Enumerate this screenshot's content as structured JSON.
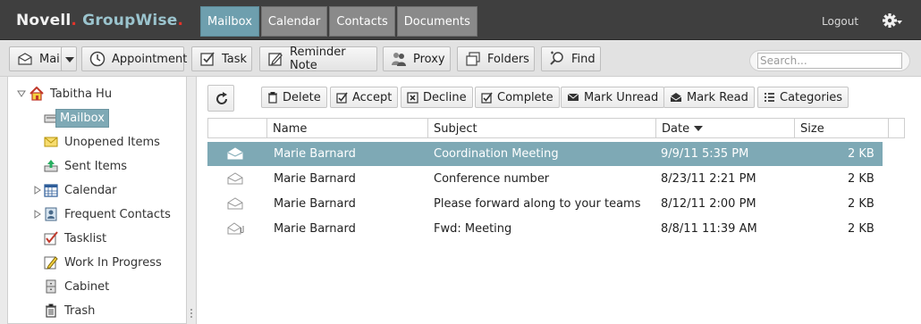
{
  "brand": {
    "novell": "Novell",
    "dot": ".",
    "groupwise": "GroupWise",
    "dot2": "."
  },
  "topnav": {
    "tabs": [
      "Mailbox",
      "Calendar",
      "Contacts",
      "Documents"
    ],
    "active_tab": "Mailbox"
  },
  "header": {
    "logout_label": "Logout",
    "settings_icon": "gear-icon"
  },
  "toolbar": {
    "mail_label": "Mail",
    "appointment_label": "Appointment",
    "task_label": "Task",
    "reminder_note_label": "Reminder Note",
    "proxy_label": "Proxy",
    "folders_label": "Folders",
    "find_label": "Find",
    "search_placeholder": "Search..."
  },
  "sidebar": {
    "user": "Tabitha Hu",
    "items": [
      {
        "label": "Mailbox",
        "icon": "mailbox-icon",
        "selected": true
      },
      {
        "label": "Unopened Items",
        "icon": "envelope-icon"
      },
      {
        "label": "Sent Items",
        "icon": "sent-items-icon"
      },
      {
        "label": "Calendar",
        "icon": "calendar-icon",
        "expandable": true
      },
      {
        "label": "Frequent Contacts",
        "icon": "contacts-icon",
        "expandable": true
      },
      {
        "label": "Tasklist",
        "icon": "checkmark-icon"
      },
      {
        "label": "Work In Progress",
        "icon": "pencil-note-icon"
      },
      {
        "label": "Cabinet",
        "icon": "cabinet-icon"
      },
      {
        "label": "Trash",
        "icon": "trash-icon"
      }
    ]
  },
  "actions": {
    "delete_label": "Delete",
    "accept_label": "Accept",
    "decline_label": "Decline",
    "complete_label": "Complete",
    "mark_unread_label": "Mark Unread",
    "mark_read_label": "Mark Read",
    "categories_label": "Categories"
  },
  "table": {
    "columns": {
      "name": "Name",
      "subject": "Subject",
      "date": "Date",
      "size": "Size"
    },
    "sort_column": "Date",
    "rows": [
      {
        "name": "Marie Barnard",
        "subject": "Coordination Meeting",
        "date": "9/9/11 5:35 PM",
        "size": "2 KB",
        "selected": true,
        "attachment": false
      },
      {
        "name": "Marie Barnard",
        "subject": "Conference number",
        "date": "8/23/11 2:21 PM",
        "size": "2 KB",
        "selected": false,
        "attachment": false
      },
      {
        "name": "Marie Barnard",
        "subject": "Please forward along to your teams",
        "date": "8/12/11 2:00 PM",
        "size": "2 KB",
        "selected": false,
        "attachment": false
      },
      {
        "name": "Marie Barnard",
        "subject": "Fwd: Meeting",
        "date": "8/8/11 11:39 AM",
        "size": "2 KB",
        "selected": false,
        "attachment": true
      }
    ]
  },
  "colors": {
    "accent": "#7ea9b5",
    "topbar": "#3f3f3f",
    "brand_gw": "#9bc4ce",
    "brand_dot": "#e4342a"
  }
}
